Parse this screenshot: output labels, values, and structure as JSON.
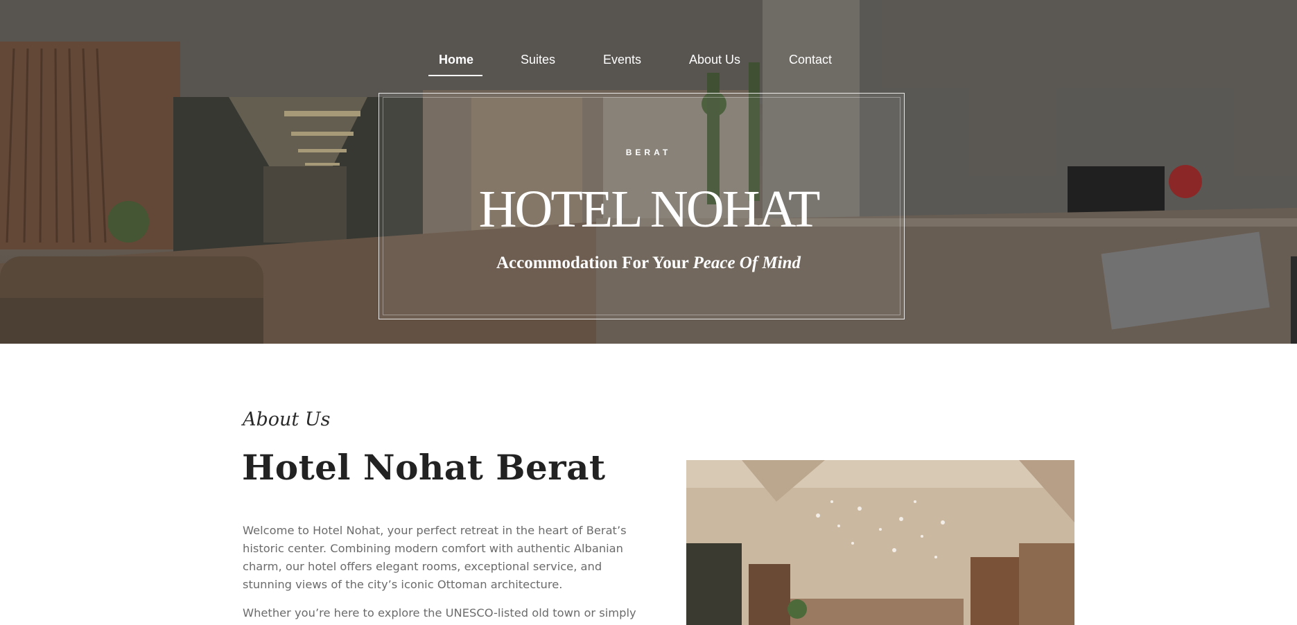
{
  "nav": {
    "items": [
      {
        "label": "Home",
        "active": true
      },
      {
        "label": "Suites",
        "active": false
      },
      {
        "label": "Events",
        "active": false
      },
      {
        "label": "About Us",
        "active": false
      },
      {
        "label": "Contact",
        "active": false
      }
    ]
  },
  "hero": {
    "kicker": "BERAT",
    "title": "HOTEL NOHAT",
    "tagline_plain": "Accommodation For Your ",
    "tagline_emphasis": "Peace Of Mind"
  },
  "about": {
    "kicker": "About Us",
    "title": "Hotel Nohat Berat",
    "paragraph1": "Welcome to Hotel Nohat, your perfect retreat in the heart of Berat’s historic center. Combining modern comfort with authentic Albanian charm, our hotel offers elegant rooms, exceptional service, and stunning views of the city’s iconic Ottoman architecture.",
    "paragraph2": "Whether you’re here to explore the UNESCO-listed old town or simply"
  },
  "icons": {
    "hero_background": "hotel-lobby-photo",
    "about_image": "lobby-chandelier-photo"
  },
  "colors": {
    "text_dark": "#222222",
    "text_muted": "#6b6b6b",
    "hero_text": "#ffffff"
  }
}
